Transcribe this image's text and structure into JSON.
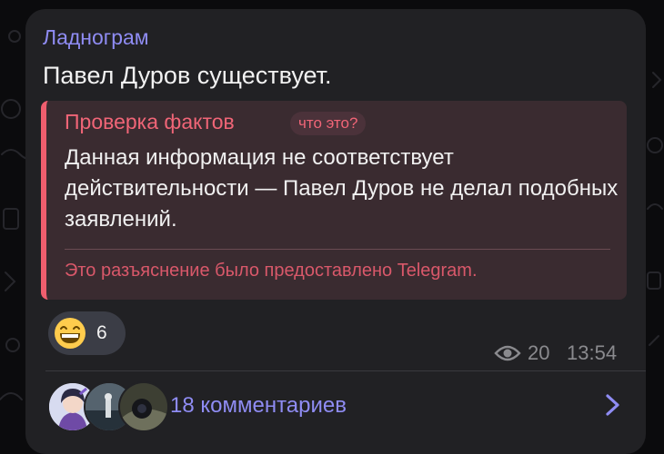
{
  "message": {
    "channel_name": "Ладнограм",
    "text": "Павел Дуров существует."
  },
  "fact_check": {
    "title": "Проверка фактов",
    "badge": "что это?",
    "body": "Данная информация не соответствует действительности — Павел Дуров не делал подобных заявлений.",
    "footer": "Это разъяснение было предоставлено Telegram."
  },
  "reaction": {
    "emoji": "grinning-face-icon",
    "count": "6"
  },
  "meta": {
    "views_icon": "eye-icon",
    "views": "20",
    "time": "13:54"
  },
  "comments": {
    "label": "18 комментариев",
    "chevron_icon": "chevron-right-icon"
  },
  "colors": {
    "background": "#0b0b0d",
    "bubble": "#212124",
    "accent": "#8f8cf3",
    "factcheck_accent": "#ef5e6e",
    "factcheck_bg": "#3a2b30"
  }
}
